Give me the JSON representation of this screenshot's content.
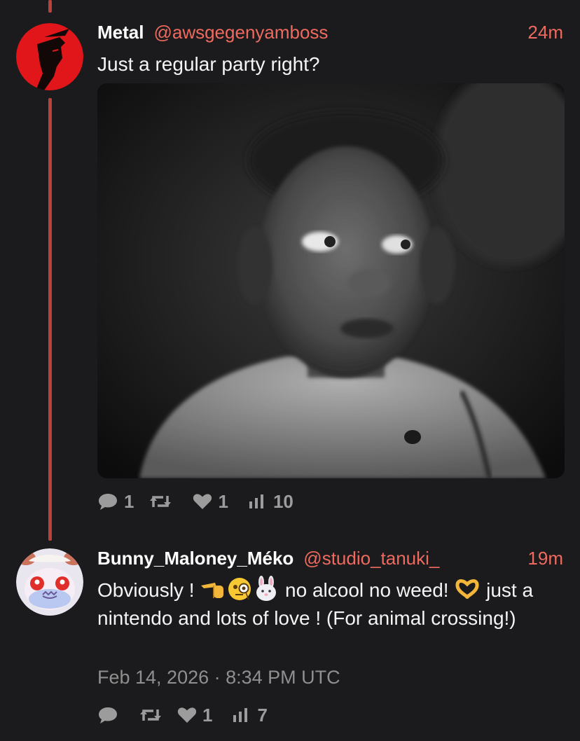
{
  "post1": {
    "name": "Metal",
    "handle": "@awsgegenyamboss",
    "time": "24m",
    "text": "Just a regular party right?",
    "stats": {
      "replies": "1",
      "reposts": "",
      "likes": "1",
      "views": "10"
    }
  },
  "post2": {
    "name": "Bunny_Maloney_Méko",
    "handle": "@studio_tanuki_",
    "time": "19m",
    "text_a": "Obviously ! ",
    "text_b": " no alcool no weed! ",
    "text_c": " just a nintendo and lots of love ! (For animal crossing!)",
    "emojis": [
      "pointing-hand-emoji",
      "monocle-face-emoji",
      "rabbit-face-emoji",
      "heart-hands-emoji"
    ],
    "date": "Feb 14, 2026 · 8:34 PM UTC",
    "stats": {
      "replies": "",
      "reposts": "",
      "likes": "1",
      "views": "7"
    }
  },
  "colors": {
    "accent": "#ee6a5e",
    "thread_line": "#b8433d",
    "background": "#1b1b1d",
    "muted": "#9c9c9c"
  },
  "icons": [
    "reply-icon",
    "repost-icon",
    "like-icon",
    "views-icon"
  ]
}
